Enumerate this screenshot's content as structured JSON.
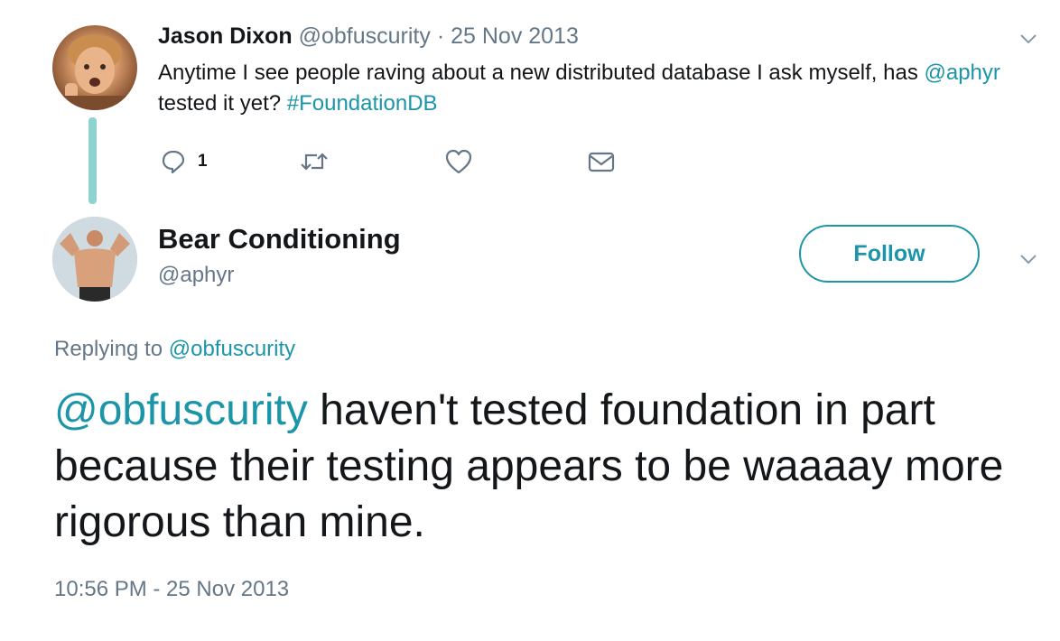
{
  "parent_tweet": {
    "author_name": "Jason Dixon",
    "author_handle": "@obfuscurity",
    "separator": "·",
    "date": "25 Nov 2013",
    "text_before_mention": "Anytime I see people raving about a new distributed database I ask myself, has",
    "mention": "@aphyr",
    "text_middle": " tested it yet? ",
    "hashtag": "#FoundationDB",
    "reply_count": "1",
    "icons": {
      "reply": "reply-icon",
      "retweet": "retweet-icon",
      "like": "heart-icon",
      "message": "envelope-icon",
      "menu": "chevron-down-icon"
    }
  },
  "reply_tweet": {
    "author_name": "Bear Conditioning",
    "author_handle": "@aphyr",
    "follow_label": "Follow",
    "replying_to_label": "Replying to ",
    "replying_to_handle": "@obfuscurity",
    "mention": "@obfuscurity",
    "text": " haven't tested foundation in part because their testing appears to be waaaay more rigorous than mine.",
    "timestamp": "10:56 PM - 25 Nov 2013"
  },
  "colors": {
    "accent": "#1b95a8",
    "muted": "#657786",
    "text": "#14171a",
    "thread_line": "#8fd3d1"
  }
}
